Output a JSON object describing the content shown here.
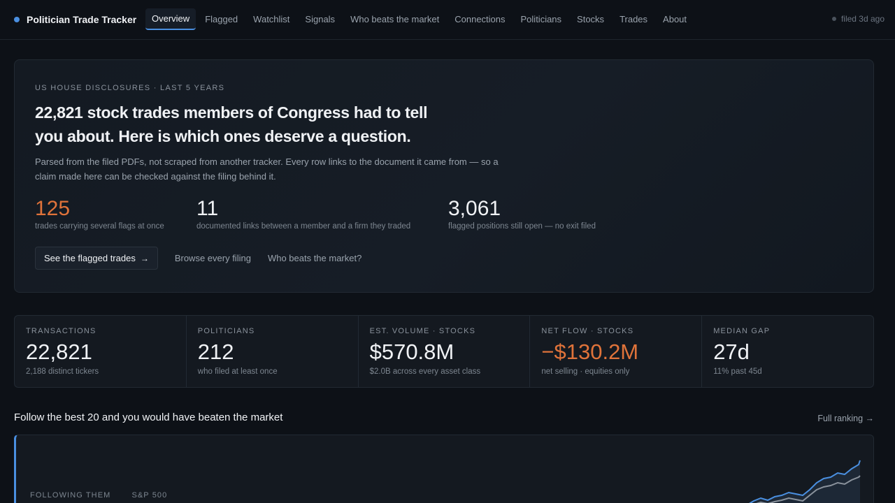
{
  "brand": {
    "name": "Politician Trade Tracker",
    "accent": "#4a8fe0"
  },
  "nav": {
    "tabs": [
      {
        "label": "Overview",
        "active": true
      },
      {
        "label": "Flagged"
      },
      {
        "label": "Watchlist"
      },
      {
        "label": "Signals"
      },
      {
        "label": "Who beats the market"
      },
      {
        "label": "Connections"
      },
      {
        "label": "Politicians"
      },
      {
        "label": "Stocks"
      },
      {
        "label": "Trades"
      },
      {
        "label": "About"
      }
    ],
    "status": "filed 3d ago"
  },
  "hero": {
    "eyebrow": "US HOUSE DISCLOSURES · LAST 5 YEARS",
    "title": "22,821 stock trades members of Congress had to tell you about. Here is which ones deserve a question.",
    "description": "Parsed from the filed PDFs, not scraped from another tracker. Every row links to the document it came from — so a claim made here can be checked against the filing behind it.",
    "stats": [
      {
        "value": "125",
        "label": "trades carrying several flags at once"
      },
      {
        "value": "11",
        "label": "documented links between a member and a firm they traded"
      },
      {
        "value": "3,061",
        "label": "flagged positions still open — no exit filed"
      }
    ],
    "primary_button": "See the flagged trades",
    "links": [
      "Browse every filing",
      "Who beats the market?"
    ]
  },
  "stats": [
    {
      "label": "TRANSACTIONS",
      "value": "22,821",
      "sub": "2,188 distinct tickers"
    },
    {
      "label": "POLITICIANS",
      "value": "212",
      "sub": "who filed at least once"
    },
    {
      "label": "EST. VOLUME · STOCKS",
      "value": "$570.8M",
      "sub": "$2.0B across every asset class"
    },
    {
      "label": "NET FLOW · STOCKS",
      "value": "−$130.2M",
      "sub": "net selling · equities only"
    },
    {
      "label": "MEDIAN GAP",
      "value": "27d",
      "sub": "11% past 45d"
    }
  ],
  "colors": {
    "negative": "#e0733a",
    "series_following": "#4a8fe0",
    "series_sp500": "#8a929c"
  },
  "section": {
    "title": "Follow the best 20 and you would have beaten the market",
    "link": "Full ranking →"
  },
  "chart": {
    "legend": [
      "FOLLOWING THEM",
      "S&P 500"
    ]
  }
}
